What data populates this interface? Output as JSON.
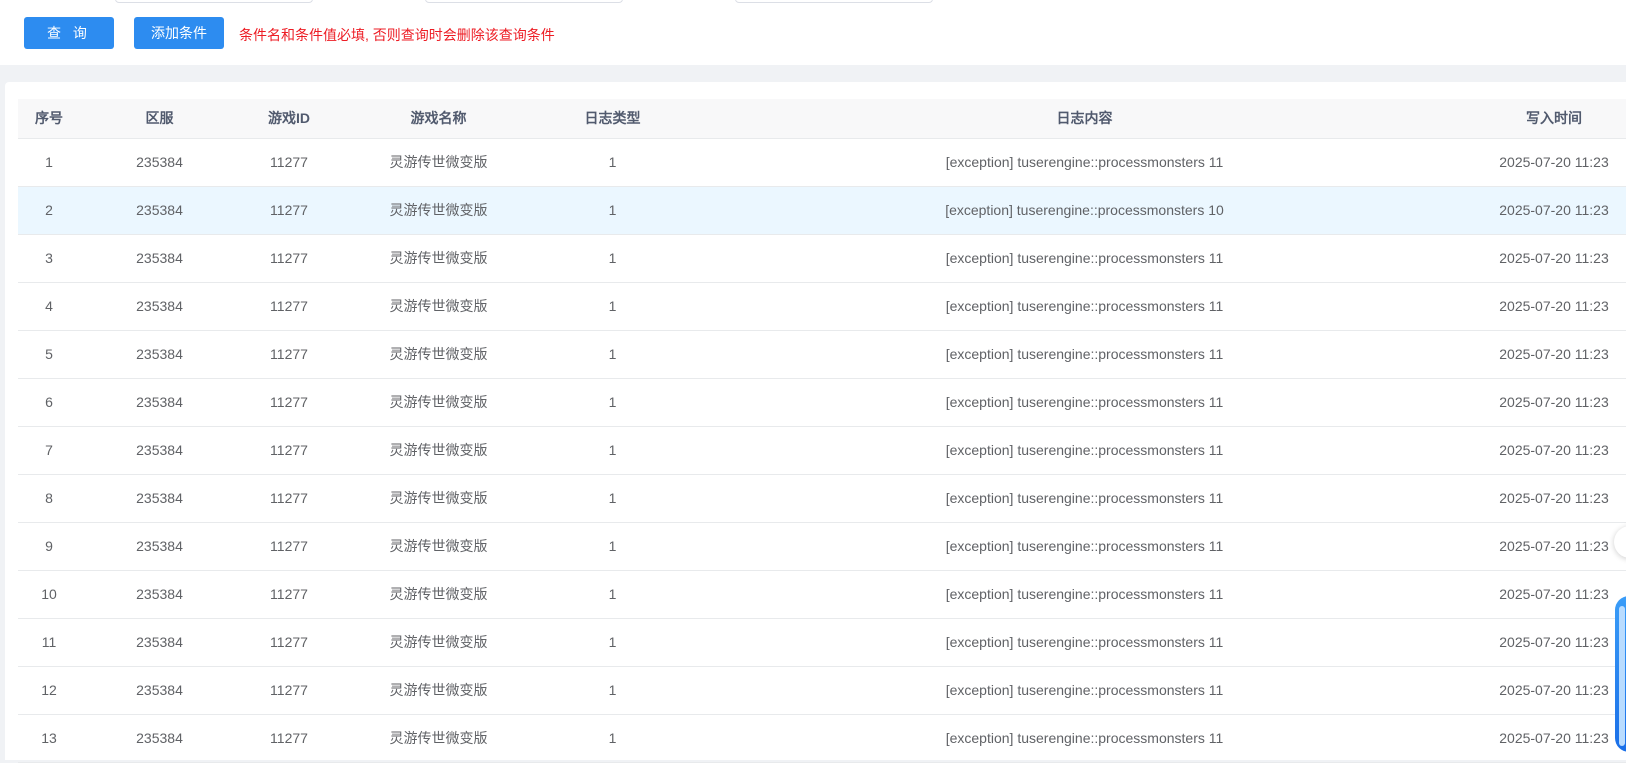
{
  "toolbar": {
    "query_label": "查 询",
    "add_condition_label": "添加条件",
    "hint": "条件名和条件值必填, 否则查询时会删除该查询条件"
  },
  "table": {
    "columns": [
      "序号",
      "区服",
      "游戏ID",
      "游戏名称",
      "日志类型",
      "日志内容",
      "写入时间"
    ],
    "rows": [
      [
        "1",
        "235384",
        "11277",
        "灵游传世微变版",
        "1",
        "[exception] tuserengine::processmonsters 11",
        "2025-07-20 11:23"
      ],
      [
        "2",
        "235384",
        "11277",
        "灵游传世微变版",
        "1",
        "[exception] tuserengine::processmonsters 10",
        "2025-07-20 11:23"
      ],
      [
        "3",
        "235384",
        "11277",
        "灵游传世微变版",
        "1",
        "[exception] tuserengine::processmonsters 11",
        "2025-07-20 11:23"
      ],
      [
        "4",
        "235384",
        "11277",
        "灵游传世微变版",
        "1",
        "[exception] tuserengine::processmonsters 11",
        "2025-07-20 11:23"
      ],
      [
        "5",
        "235384",
        "11277",
        "灵游传世微变版",
        "1",
        "[exception] tuserengine::processmonsters 11",
        "2025-07-20 11:23"
      ],
      [
        "6",
        "235384",
        "11277",
        "灵游传世微变版",
        "1",
        "[exception] tuserengine::processmonsters 11",
        "2025-07-20 11:23"
      ],
      [
        "7",
        "235384",
        "11277",
        "灵游传世微变版",
        "1",
        "[exception] tuserengine::processmonsters 11",
        "2025-07-20 11:23"
      ],
      [
        "8",
        "235384",
        "11277",
        "灵游传世微变版",
        "1",
        "[exception] tuserengine::processmonsters 11",
        "2025-07-20 11:23"
      ],
      [
        "9",
        "235384",
        "11277",
        "灵游传世微变版",
        "1",
        "[exception] tuserengine::processmonsters 11",
        "2025-07-20 11:23"
      ],
      [
        "10",
        "235384",
        "11277",
        "灵游传世微变版",
        "1",
        "[exception] tuserengine::processmonsters 11",
        "2025-07-20 11:23"
      ],
      [
        "11",
        "235384",
        "11277",
        "灵游传世微变版",
        "1",
        "[exception] tuserengine::processmonsters 11",
        "2025-07-20 11:23"
      ],
      [
        "12",
        "235384",
        "11277",
        "灵游传世微变版",
        "1",
        "[exception] tuserengine::processmonsters 11",
        "2025-07-20 11:23"
      ],
      [
        "13",
        "235384",
        "11277",
        "灵游传世微变版",
        "1",
        "[exception] tuserengine::processmonsters 11",
        "2025-07-20 11:23"
      ]
    ],
    "highlighted_row": 1
  },
  "colors": {
    "primary": "#2d8cf0",
    "hint": "#ed1c24",
    "row_highlight": "#ebf7ff"
  }
}
